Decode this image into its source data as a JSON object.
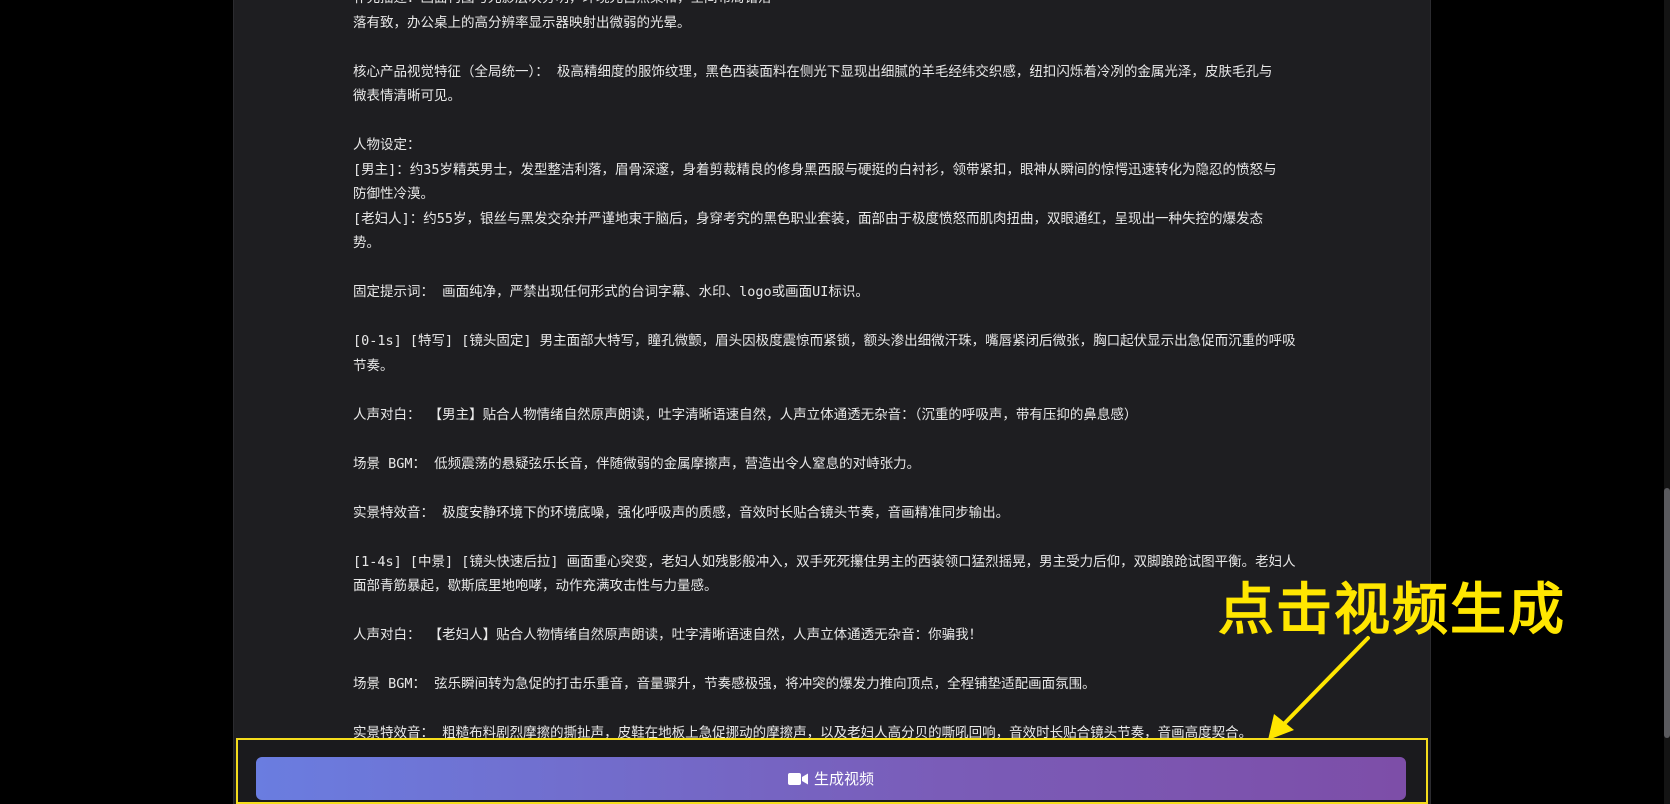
{
  "script": {
    "paragraphs": [
      {
        "lines": [
          "补充描述：画面构图与光影层次分明，环境光自然柔和，空间布局错落",
          "落有致，办公桌上的高分辨率显示器映射出微弱的光晕。"
        ]
      },
      {
        "lines": [
          "核心产品视觉特征（全局统一）： 极高精细度的服饰纹理，黑色西装面料在侧光下显现出细腻的羊毛经纬交织感，纽扣闪烁着冷冽的金属光泽，皮肤毛孔与",
          "微表情清晰可见。"
        ]
      },
      {
        "lines": [
          "人物设定：",
          "[男主]：约35岁精英男士，发型整洁利落，眉骨深邃，身着剪裁精良的修身黑西服与硬挺的白衬衫，领带紧扣，眼神从瞬间的惊愕迅速转化为隐忍的愤怒与",
          "防御性冷漠。",
          "[老妇人]：约55岁，银丝与黑发交杂并严谨地束于脑后，身穿考究的黑色职业套装，面部由于极度愤怒而肌肉扭曲，双眼通红，呈现出一种失控的爆发态",
          "势。"
        ]
      },
      {
        "lines": [
          "固定提示词： 画面纯净，严禁出现任何形式的台词字幕、水印、logo或画面UI标识。"
        ]
      },
      {
        "lines": [
          "[0-1s] [特写] [镜头固定] 男主面部大特写，瞳孔微颤，眉头因极度震惊而紧锁，额头渗出细微汗珠，嘴唇紧闭后微张，胸口起伏显示出急促而沉重的呼吸",
          "节奏。"
        ]
      },
      {
        "lines": [
          "人声对白： 【男主】贴合人物情绪自然原声朗读，吐字清晰语速自然，人声立体通透无杂音：（沉重的呼吸声，带有压抑的鼻息感）"
        ]
      },
      {
        "lines": [
          "场景 BGM： 低频震荡的悬疑弦乐长音，伴随微弱的金属摩擦声，营造出令人窒息的对峙张力。"
        ]
      },
      {
        "lines": [
          "实景特效音： 极度安静环境下的环境底噪，强化呼吸声的质感，音效时长贴合镜头节奏，音画精准同步输出。"
        ]
      },
      {
        "lines": [
          "[1-4s] [中景] [镜头快速后拉] 画面重心突变，老妇人如残影般冲入，双手死死攥住男主的西装领口猛烈摇晃，男主受力后仰，双脚踉跄试图平衡。老妇人",
          "面部青筋暴起，歇斯底里地咆哮，动作充满攻击性与力量感。"
        ]
      },
      {
        "lines": [
          "人声对白： 【老妇人】贴合人物情绪自然原声朗读，吐字清晰语速自然，人声立体通透无杂音：你骗我！"
        ]
      },
      {
        "lines": [
          "场景 BGM： 弦乐瞬间转为急促的打击乐重音，音量骤升，节奏感极强，将冲突的爆发力推向顶点，全程铺垫适配画面氛围。"
        ]
      },
      {
        "lines": [
          "实景特效音： 粗糙布料剧烈摩擦的撕扯声，皮鞋在地板上急促挪动的摩擦声，以及老妇人高分贝的嘶吼回响，音效时长贴合镜头节奏，音画高度契合。"
        ]
      }
    ]
  },
  "generate_button": {
    "label": "生成视频",
    "icon": "video-camera-icon"
  },
  "annotation": {
    "text": "点击视频生成",
    "color": "#ffe600"
  },
  "colors": {
    "highlight_border": "#f5dd1c",
    "button_gradient_start": "#6a7de0",
    "button_gradient_end": "#7d4ea8"
  }
}
